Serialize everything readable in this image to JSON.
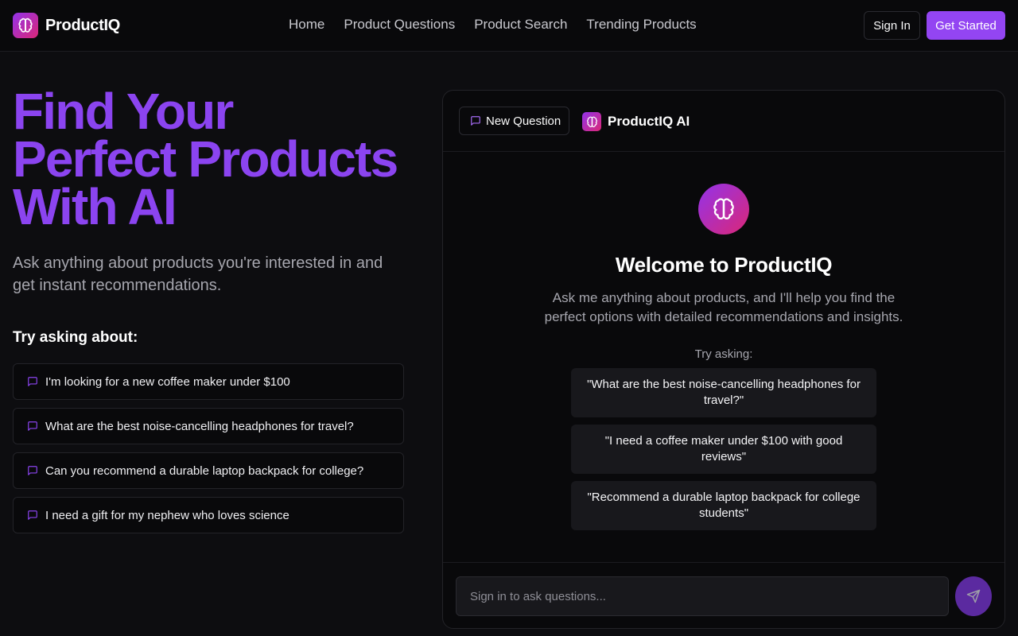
{
  "brand": {
    "name": "ProductIQ",
    "accent": "#9345f2",
    "gradient": [
      "#9333ea",
      "#db2777"
    ]
  },
  "nav": {
    "items": [
      "Home",
      "Product Questions",
      "Product Search",
      "Trending Products"
    ]
  },
  "auth": {
    "sign_in": "Sign In",
    "get_started": "Get Started"
  },
  "hero": {
    "title_lines": [
      "Find Your",
      "Perfect Products",
      "With AI"
    ],
    "subtitle": "Ask anything about products you're interested in and get instant recommendations."
  },
  "suggestions": {
    "title": "Try asking about:",
    "items": [
      "I'm looking for a new coffee maker under $100",
      "What are the best noise-cancelling headphones for travel?",
      "Can you recommend a durable laptop backpack for college?",
      "I need a gift for my nephew who loves science"
    ]
  },
  "chat": {
    "new_question": "New Question",
    "assistant_name": "ProductIQ AI",
    "welcome_title": "Welcome to ProductIQ",
    "welcome_text": "Ask me anything about products, and I'll help you find the perfect options with detailed recommendations and insights.",
    "try_label": "Try asking:",
    "examples": [
      "\"What are the best noise-cancelling headphones for travel?\"",
      "\"I need a coffee maker under $100 with good reviews\"",
      "\"Recommend a durable laptop backpack for college students\""
    ],
    "input_placeholder": "Sign in to ask questions...",
    "input_value": ""
  },
  "icons": {
    "logo": "brain-icon",
    "suggestion": "message-square-icon",
    "new_question": "message-square-icon",
    "send": "send-icon"
  }
}
